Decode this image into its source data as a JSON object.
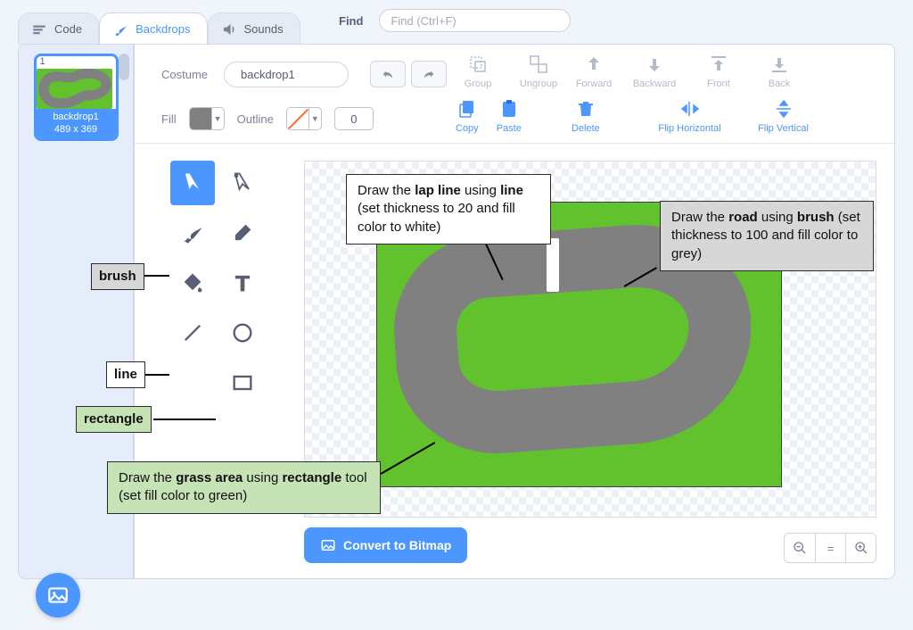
{
  "tabs": {
    "code": "Code",
    "backdrops": "Backdrops",
    "sounds": "Sounds"
  },
  "find": {
    "label": "Find",
    "placeholder": "Find (Ctrl+F)"
  },
  "thumb": {
    "number": "1",
    "name": "backdrop1",
    "dims": "489 x 369"
  },
  "row1": {
    "costume_label": "Costume",
    "costume_name": "backdrop1"
  },
  "actions": {
    "group": "Group",
    "ungroup": "Ungroup",
    "forward": "Forward",
    "backward": "Backward",
    "front": "Front",
    "back": "Back",
    "copy": "Copy",
    "paste": "Paste",
    "delete": "Delete",
    "flip_h": "Flip Horizontal",
    "flip_v": "Flip Vertical"
  },
  "fill": {
    "label": "Fill",
    "color": "#808080"
  },
  "outline": {
    "label": "Outline",
    "value": "0"
  },
  "convert": "Convert to Bitmap",
  "zoom": {
    "out": "−",
    "reset": "=",
    "in": "+"
  },
  "callouts": {
    "brush": "brush",
    "line": "line",
    "rectangle": "rectangle",
    "lap_p1": "Draw the ",
    "lap_b": "lap line",
    "lap_p2": " using ",
    "lap_b2": "line",
    "lap_p3": " (set thickness to 20 and fill color to white)",
    "road_p1": "Draw the ",
    "road_b": "road",
    "road_p2": " using ",
    "road_b2": "brush",
    "road_p3": " (set thickness to 100 and fill color to grey)",
    "grass_p1": "Draw the ",
    "grass_b": "grass area",
    "grass_p2": " using ",
    "grass_b2": "rectangle",
    "grass_p3": " tool (set fill color to green)"
  }
}
